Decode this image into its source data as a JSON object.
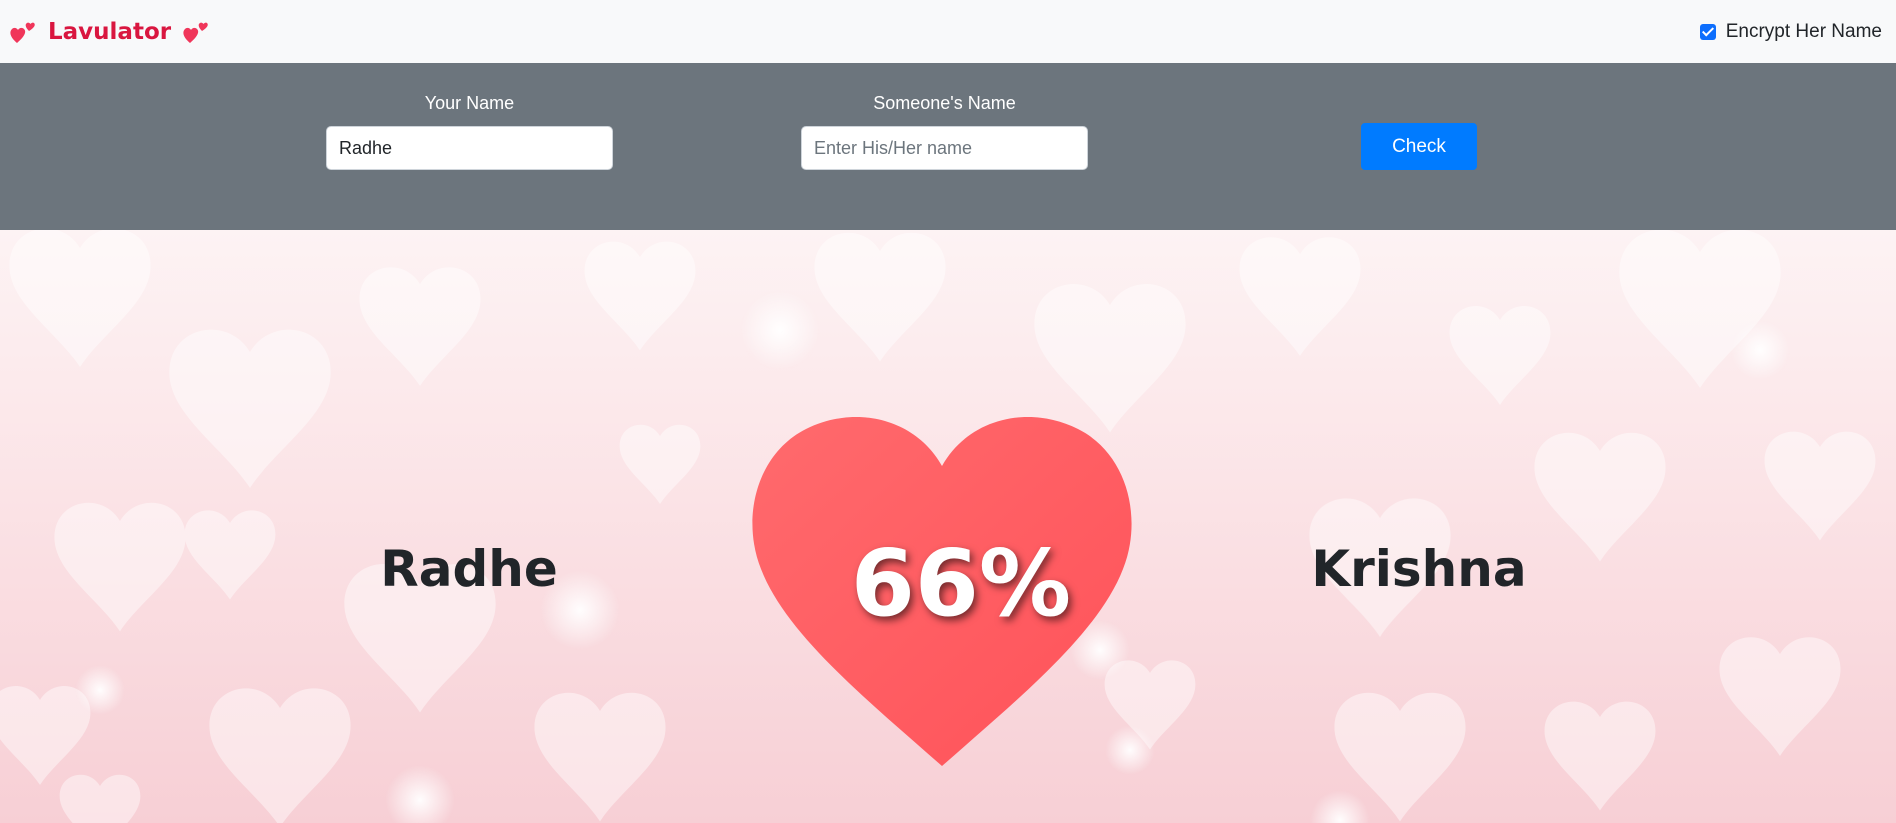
{
  "navbar": {
    "brand_title": "Lavulator",
    "brand_icon": "two-hearts-icon",
    "encrypt_label": "Encrypt Her Name",
    "encrypt_checked": true
  },
  "form": {
    "your_name_label": "Your Name",
    "your_name_value": "Radhe",
    "someone_name_label": "Someone's Name",
    "someone_name_placeholder": "Enter His/Her name",
    "someone_name_value": "",
    "check_label": "Check"
  },
  "result": {
    "name_left": "Radhe",
    "percentage": "66%",
    "name_right": "Krishna"
  },
  "colors": {
    "brand": "#d9163f",
    "band": "#6c757d",
    "button": "#007bff",
    "heart": "#ff5e63"
  }
}
